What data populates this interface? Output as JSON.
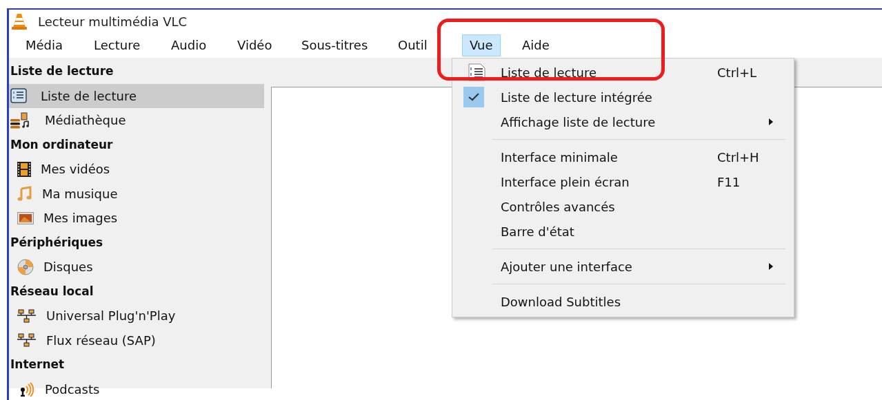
{
  "window": {
    "title": "Lecteur multimédia VLC"
  },
  "menu_bar": [
    {
      "label": "Média",
      "selected": false
    },
    {
      "label": "Lecture",
      "selected": false
    },
    {
      "label": "Audio",
      "selected": false
    },
    {
      "label": "Vidéo",
      "selected": false
    },
    {
      "label": "Sous-titres",
      "selected": false
    },
    {
      "label": "Outil",
      "selected": false
    },
    {
      "label": "Vue",
      "selected": true
    },
    {
      "label": "Aide",
      "selected": false
    }
  ],
  "sidebar": [
    {
      "title": "Liste de lecture",
      "items": [
        {
          "label": "Liste de lecture",
          "selected": true
        },
        {
          "label": "Médiathèque",
          "selected": false
        }
      ]
    },
    {
      "title": "Mon ordinateur",
      "items": [
        {
          "label": "Mes vidéos",
          "selected": false
        },
        {
          "label": "Ma musique",
          "selected": false
        },
        {
          "label": "Mes images",
          "selected": false
        }
      ]
    },
    {
      "title": "Périphériques",
      "items": [
        {
          "label": "Disques",
          "selected": false
        }
      ]
    },
    {
      "title": "Réseau local",
      "items": [
        {
          "label": "Universal Plug'n'Play",
          "selected": false
        },
        {
          "label": "Flux réseau (SAP)",
          "selected": false
        }
      ]
    },
    {
      "title": "Internet",
      "items": [
        {
          "label": "Podcasts",
          "selected": false
        }
      ]
    }
  ],
  "dropdown_menu": [
    {
      "kind": "item",
      "label": "Liste de lecture",
      "shortcut": "Ctrl+L",
      "checked": false,
      "submenu": false
    },
    {
      "kind": "item",
      "label": "Liste de lecture intégrée",
      "checked": true,
      "submenu": false
    },
    {
      "kind": "item",
      "label": "Affichage liste de lecture",
      "checked": false,
      "submenu": true
    },
    {
      "kind": "separator"
    },
    {
      "kind": "item",
      "label": "Interface minimale",
      "shortcut": "Ctrl+H",
      "checked": false,
      "submenu": false
    },
    {
      "kind": "item",
      "label": "Interface plein écran",
      "shortcut": "F11",
      "checked": false,
      "submenu": false
    },
    {
      "kind": "item",
      "label": "Contrôles avancés",
      "checked": false,
      "submenu": false
    },
    {
      "kind": "item",
      "label": "Barre d'état",
      "checked": false,
      "submenu": false
    },
    {
      "kind": "separator"
    },
    {
      "kind": "item",
      "label": "Ajouter une interface",
      "checked": false,
      "submenu": true
    },
    {
      "kind": "separator"
    },
    {
      "kind": "item",
      "label": "Download Subtitles",
      "checked": false,
      "submenu": false
    }
  ]
}
